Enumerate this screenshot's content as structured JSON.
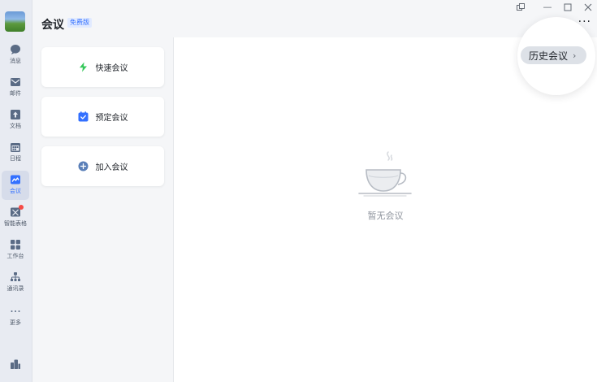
{
  "app": {
    "title": "会议",
    "badge": "免费版"
  },
  "rail": {
    "items": [
      {
        "label": "消息",
        "icon": "message-icon"
      },
      {
        "label": "邮件",
        "icon": "mail-icon"
      },
      {
        "label": "文档",
        "icon": "docs-icon"
      },
      {
        "label": "日程",
        "icon": "calendar-icon"
      },
      {
        "label": "会议",
        "icon": "meeting-icon"
      },
      {
        "label": "智能表格",
        "icon": "smart-sheet-icon"
      },
      {
        "label": "工作台",
        "icon": "workbench-icon"
      },
      {
        "label": "通讯录",
        "icon": "contacts-icon"
      },
      {
        "label": "更多",
        "icon": "more-dots-icon"
      }
    ],
    "active": "会议"
  },
  "cards": {
    "quick": "快速会议",
    "schedule": "预定会议",
    "join": "加入会议"
  },
  "main": {
    "empty_text": "暂无会议"
  },
  "history": {
    "label": "历史会议",
    "chevron": "›"
  },
  "window": {
    "minimize": "—",
    "more": "···"
  },
  "colors": {
    "accent": "#3370ff",
    "quick_meeting": "#34c759",
    "join_meeting": "#5a7fb8",
    "notification": "#f54a45"
  }
}
